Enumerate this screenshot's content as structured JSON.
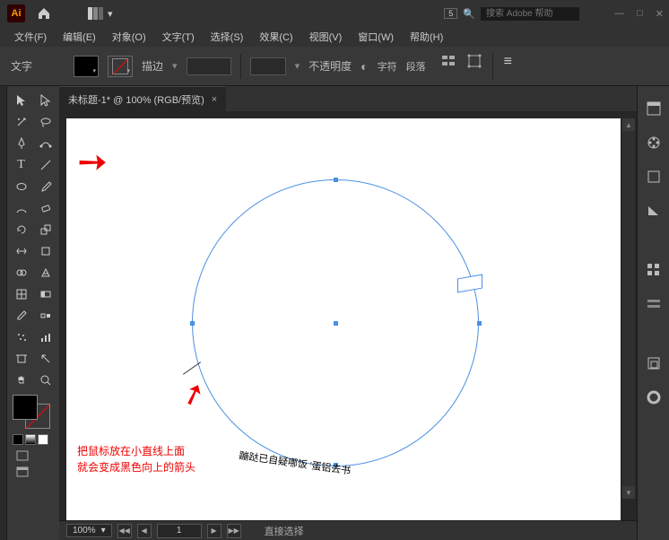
{
  "app": {
    "logo": "Ai",
    "search_badge": "5",
    "search_icon": "Q",
    "search_placeholder": "搜索 Adobe 帮助"
  },
  "window": {
    "min": "—",
    "max": "□",
    "close": "✕"
  },
  "menu": [
    "文件(F)",
    "编辑(E)",
    "对象(O)",
    "文字(T)",
    "选择(S)",
    "效果(C)",
    "视图(V)",
    "窗口(W)",
    "帮助(H)"
  ],
  "control": {
    "type_label": "文字",
    "stroke_label": "描边",
    "stroke_dd": "▾",
    "opacity_label": "不透明度",
    "char_label": "字符",
    "para_label": "段落",
    "dd": "▾"
  },
  "tab": {
    "title": "未标题-1* @ 100% (RGB/预览)",
    "close": "×"
  },
  "canvas": {
    "note_line1": "把鼠标放在小直线上面",
    "note_line2": "就会变成黑色向上的箭头",
    "path_text": "蹦跶已自疑哪饭 '蛋铝去书"
  },
  "status": {
    "zoom": "100%",
    "zoom_dd": "▾",
    "prev": "◀",
    "next": "▶",
    "page": "1",
    "tool": "直接选择"
  },
  "icons": {
    "home": "⌂",
    "chevdown": "▾",
    "globe": "◐",
    "menu": "≡",
    "grid": "▦"
  }
}
